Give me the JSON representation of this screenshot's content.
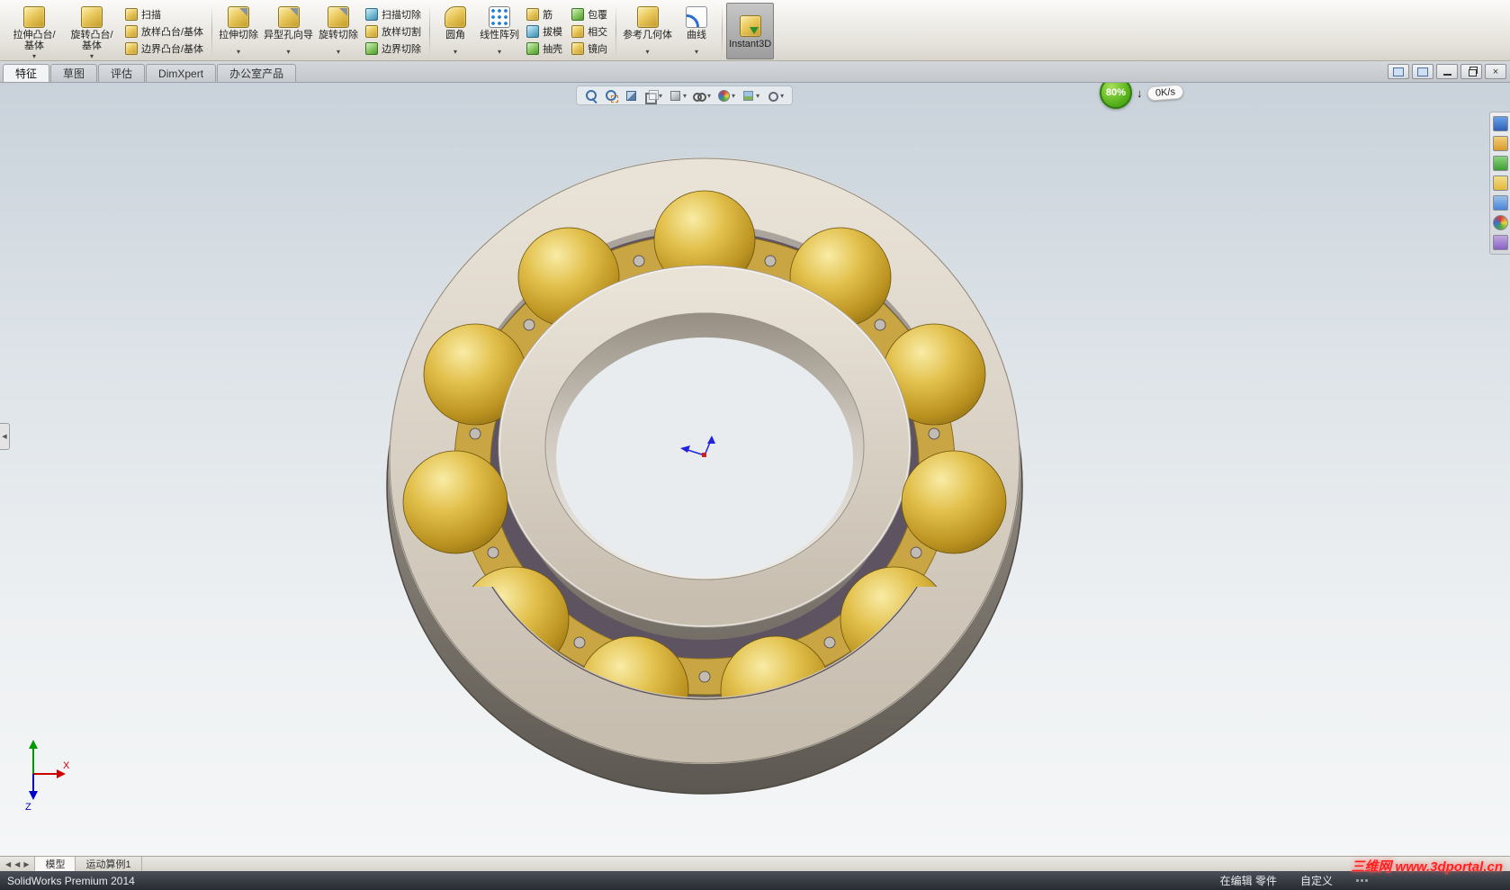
{
  "ribbon": {
    "groups": [
      {
        "big": [
          {
            "label": "拉伸凸台/基体"
          },
          {
            "label": "旋转凸台/基体"
          }
        ],
        "small": [
          {
            "label": "扫描"
          },
          {
            "label": "放样凸台/基体"
          },
          {
            "label": "边界凸台/基体"
          }
        ]
      },
      {
        "big": [
          {
            "label": "拉伸切除"
          },
          {
            "label": "异型孔向导"
          },
          {
            "label": "旋转切除"
          }
        ],
        "small": [
          {
            "label": "扫描切除"
          },
          {
            "label": "放样切割"
          },
          {
            "label": "边界切除"
          }
        ]
      },
      {
        "big": [
          {
            "label": "圆角"
          },
          {
            "label": "线性阵列"
          }
        ],
        "small": [
          {
            "label": "筋"
          },
          {
            "label": "拔模"
          },
          {
            "label": "抽壳"
          }
        ],
        "small2": [
          {
            "label": "包覆"
          },
          {
            "label": "相交"
          },
          {
            "label": "镜向"
          }
        ]
      },
      {
        "big": [
          {
            "label": "参考几何体"
          },
          {
            "label": "曲线"
          }
        ]
      },
      {
        "big": [
          {
            "label": "Instant3D"
          }
        ]
      }
    ]
  },
  "command_tabs": {
    "items": [
      {
        "label": "特征"
      },
      {
        "label": "草图"
      },
      {
        "label": "评估"
      },
      {
        "label": "DimXpert"
      },
      {
        "label": "办公室产品"
      }
    ]
  },
  "triad": {
    "x": "X",
    "z": "Z"
  },
  "model_tabs": {
    "items": [
      {
        "label": "模型"
      },
      {
        "label": "运动算例1"
      }
    ]
  },
  "status_bar": {
    "app": "SolidWorks Premium 2014",
    "editing": "在编辑 零件",
    "customize": "自定义"
  },
  "network_overlay": {
    "percent": "80%",
    "speed": "0K/s"
  },
  "watermark": {
    "text": "三维网 www.3dportal.cn"
  }
}
